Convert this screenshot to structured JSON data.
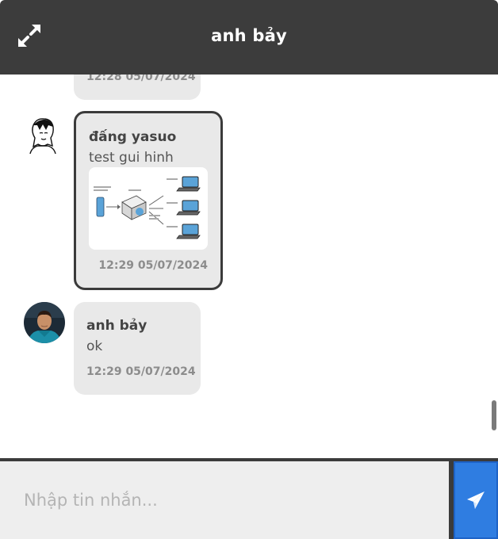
{
  "header": {
    "title": "anh bảy",
    "expand_icon": "expand-arrows-icon"
  },
  "messages": [
    {
      "time": "12:28 05/07/2024"
    },
    {
      "sender": "đấng yasuo",
      "text": "test gui hinh",
      "image_icon": "network-diagram-image",
      "time": "12:29 05/07/2024"
    },
    {
      "sender": "anh bảy",
      "text": "ok",
      "time": "12:29 05/07/2024"
    }
  ],
  "composer": {
    "placeholder": "Nhập tin nhắn...",
    "send_icon": "paper-plane-icon"
  },
  "colors": {
    "header_bg": "#3c3c3c",
    "bubble_bg": "#e9e9e9",
    "send_button": "#2f7de1"
  }
}
